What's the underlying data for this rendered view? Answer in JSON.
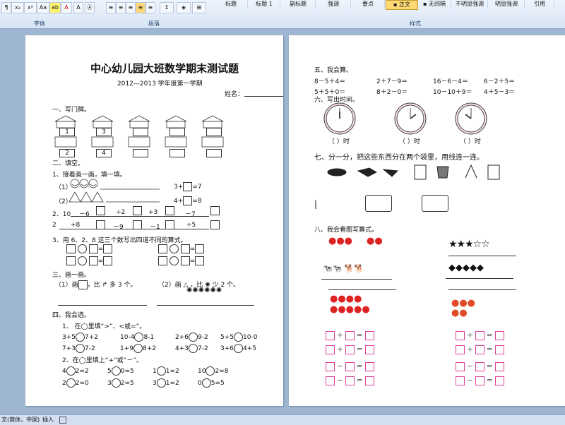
{
  "ribbon": {
    "groups": {
      "font": "字体",
      "paragraph": "段落",
      "styles": "样式"
    },
    "font_buttons": [
      "x₂",
      "x²",
      "Aa",
      "A",
      "A"
    ],
    "styles": [
      "标题",
      "标题 1",
      "副标题",
      "强调",
      "要点",
      "▪ 正文",
      "▪ 无间隔",
      "不明显强调",
      "明显强调",
      "引用"
    ]
  },
  "status": {
    "language": "文(简体，中国)",
    "mode": "插入"
  },
  "page1": {
    "title": "中心幼儿园大班数学期末测试题",
    "subtitle": "2012—2013 学年度第一学期",
    "name_label": "姓名：",
    "s1": "一、写门牌。",
    "house_numbers_top": [
      "1",
      "3",
      "",
      "",
      ""
    ],
    "house_numbers_bottom": [
      "2",
      "4",
      "",
      "",
      ""
    ],
    "s2": "二、填空。",
    "s2_1": "1、接着画一画，填一填。",
    "row1_label": "（1）",
    "row2_label": "（2）",
    "eq1": "3+",
    "eq1b": "=7",
    "eq2": "4+",
    "eq2b": "=8",
    "chain1_start": "2、10",
    "chain1_ops": [
      "－6",
      "÷2",
      "+3",
      "－7"
    ],
    "chain2_start": "2",
    "chain2_ops": [
      "+8",
      "－9",
      "－1",
      "÷5"
    ],
    "s2_3": "3、用 6、2、8 这三个数写出四道不同的算式。",
    "s3": "三、画一画。",
    "s3_a": "（1）画",
    "s3_a2": "，比",
    "s3_a3": "多 3 个。",
    "s3_b": "（2）画",
    "s3_b2": "，比",
    "s3_b3": "少 2 个。",
    "s4": "四、我会选。",
    "s4_1": "1、 在◯里填“>”、<或=”。",
    "cmp_rows": [
      [
        "3+5",
        "7+2",
        "10-4",
        "8-1",
        "2+6",
        "9-2",
        "5+5",
        "10-0"
      ],
      [
        "7+3",
        "7-2",
        "1+9",
        "8+2",
        "4+3",
        "7-2",
        "3+6",
        "4+5"
      ]
    ],
    "s4_2": "2、在◯里填上“+”或“－”。",
    "op_rows": [
      [
        "4",
        "2=2",
        "5",
        "0=5",
        "1",
        "1=2",
        "10",
        "2=8"
      ],
      [
        "2",
        "2=0",
        "3",
        "2=5",
        "3",
        "1=2",
        "0",
        "5=5"
      ]
    ]
  },
  "page2": {
    "s5": "五、我会算。",
    "calc_rows": [
      [
        "8－5＋4＝",
        "2＋7－9＝",
        "16－6－4＝",
        "6－2＋5＝"
      ],
      [
        "5＋5＋0＝",
        "8＋2－0＝",
        "10－10＋9＝",
        "4＋5－3＝"
      ]
    ],
    "s6": "六、写出时间。",
    "clock_labels": [
      "（    ）时",
      "（    ）时",
      "（    ）时"
    ],
    "s7": "七、分一分，把这些东西分在两个袋里，用线连一连。",
    "s8": "八、我会看图写算式。",
    "eq_plus": "＋",
    "eq_minus": "－",
    "eq_equal": "＝"
  },
  "colors": {
    "accent_pink": "#e0409a",
    "active_style": "#ffd975",
    "ribbon": "#d7e4f4",
    "clock_face": "#fbe3e8"
  }
}
